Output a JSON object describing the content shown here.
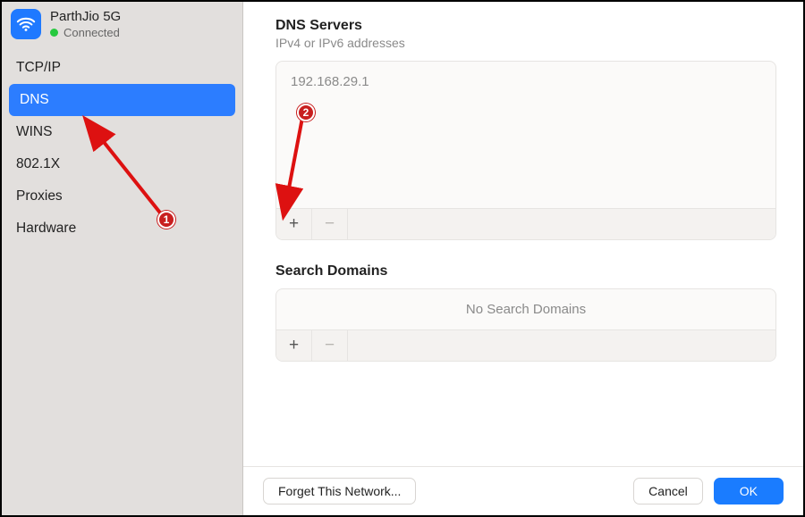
{
  "network": {
    "name": "ParthJio 5G",
    "status": "Connected"
  },
  "sidebar": {
    "tabs": [
      {
        "label": "TCP/IP"
      },
      {
        "label": "DNS"
      },
      {
        "label": "WINS"
      },
      {
        "label": "802.1X"
      },
      {
        "label": "Proxies"
      },
      {
        "label": "Hardware"
      }
    ],
    "selected_index": 1
  },
  "dns": {
    "title": "DNS Servers",
    "subtitle": "IPv4 or IPv6 addresses",
    "entries": [
      "192.168.29.1"
    ],
    "plus": "+",
    "minus": "−"
  },
  "search_domains": {
    "title": "Search Domains",
    "placeholder": "No Search Domains",
    "plus": "+",
    "minus": "−"
  },
  "footer": {
    "forget": "Forget This Network...",
    "cancel": "Cancel",
    "ok": "OK"
  },
  "annotations": {
    "badge1": "1",
    "badge2": "2"
  }
}
